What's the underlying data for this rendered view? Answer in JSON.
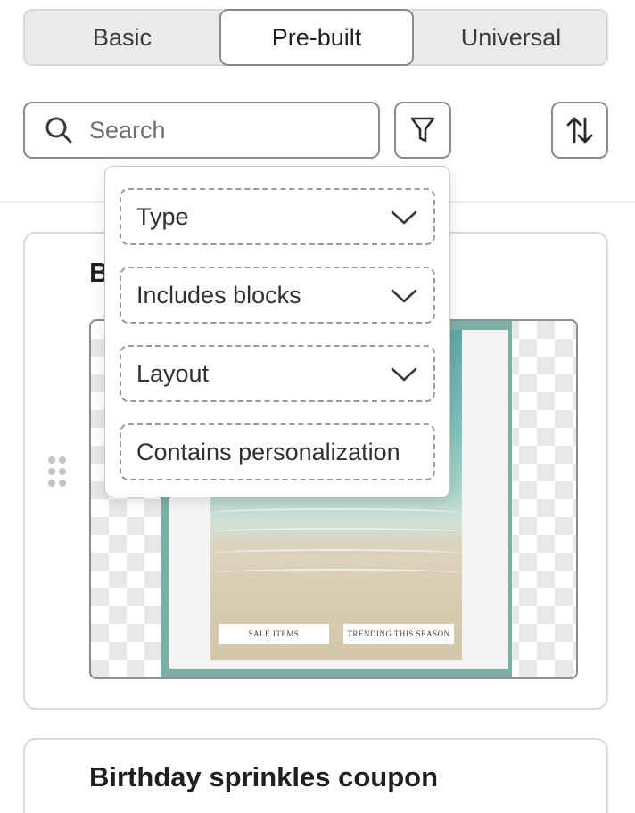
{
  "tabs": [
    {
      "label": "Basic",
      "active": false
    },
    {
      "label": "Pre-built",
      "active": true
    },
    {
      "label": "Universal",
      "active": false
    }
  ],
  "search": {
    "placeholder": "Search",
    "value": ""
  },
  "icons": {
    "search": "search-icon",
    "filter": "filter-funnel-icon",
    "sort": "sort-arrows-icon",
    "chevron": "chevron-down-icon",
    "drag": "drag-handle-icon"
  },
  "filter_menu": {
    "options": [
      {
        "label": "Type",
        "has_dropdown": true
      },
      {
        "label": "Includes blocks",
        "has_dropdown": true
      },
      {
        "label": "Layout",
        "has_dropdown": true
      },
      {
        "label": "Contains personalization",
        "has_dropdown": false
      }
    ]
  },
  "templates": [
    {
      "title": "B",
      "preview": {
        "button_1": "SALE ITEMS",
        "button_2": "TRENDING THIS SEASON"
      }
    },
    {
      "title": "Birthday sprinkles coupon"
    }
  ],
  "colors": {
    "accent_frame": "#7eafa6",
    "tab_track": "#e9eaec",
    "border": "#8c8c8c"
  }
}
